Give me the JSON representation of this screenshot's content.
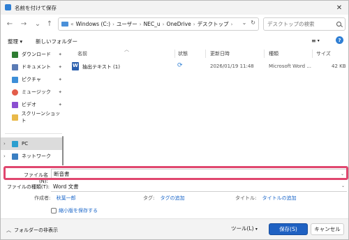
{
  "window": {
    "title": "名前を付けて保存"
  },
  "address": {
    "path": [
      "Windows (C:)",
      "ユーザー",
      "NEC_u",
      "OneDrive",
      "デスクトップ"
    ],
    "prefix": "«"
  },
  "search": {
    "placeholder": "デスクトップの検索"
  },
  "toolbar": {
    "organize": "整理 ▾",
    "new_folder": "新しいフォルダー"
  },
  "nav": {
    "items": [
      {
        "label": "ダウンロード",
        "icon": "download-icon",
        "color": "#2e7d32",
        "pinned": true
      },
      {
        "label": "ドキュメント",
        "icon": "document-icon",
        "color": "#5a7bb5",
        "pinned": true
      },
      {
        "label": "ピクチャ",
        "icon": "pictures-icon",
        "color": "#3d8fd8",
        "pinned": true
      },
      {
        "label": "ミュージック",
        "icon": "music-icon",
        "color": "#e35d4a",
        "pinned": true
      },
      {
        "label": "ビデオ",
        "icon": "video-icon",
        "color": "#8b4fd1",
        "pinned": true
      },
      {
        "label": "スクリーンショット",
        "icon": "folder-icon",
        "color": "#e9b949",
        "pinned": false
      }
    ],
    "pc": "PC",
    "network": "ネットワーク"
  },
  "columns": {
    "name": "名前",
    "state": "状態",
    "modified": "更新日時",
    "type": "種類",
    "size": "サイズ"
  },
  "files": [
    {
      "name": "抽出テキスト (1)",
      "modified": "2026/01/19 11:48",
      "type": "Microsoft Word ...",
      "size": "42 KB"
    }
  ],
  "form": {
    "filename_label": "ファイル名(N):",
    "filename_value": "断音書",
    "filetype_label": "ファイルの種類(T):",
    "filetype_value": "Word 文書",
    "author_label": "作成者:",
    "author_value": "秋葉一郎",
    "tag_label": "タグ:",
    "tag_value": "タグの追加",
    "title_label": "タイトル:",
    "title_value": "タイトルの追加",
    "thumbnail_label": "縮小版を保存する"
  },
  "bottom": {
    "hide_folders": "フォルダーの非表示",
    "tools": "ツール(L)",
    "save": "保存(S)",
    "cancel": "キャンセル"
  },
  "colors": {
    "accent": "#1f61c2",
    "highlight": "#e0476f"
  }
}
